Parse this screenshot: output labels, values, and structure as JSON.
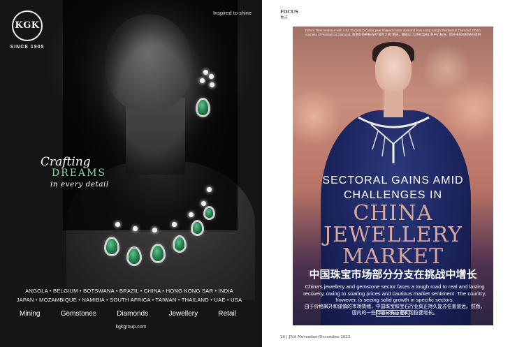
{
  "ad": {
    "logo_text": "KGK",
    "since": "SINCE 1905",
    "tagline": "Inspired to shine",
    "headline_script": "Crafting",
    "headline_main": "DREAMS",
    "headline_sub": "in every detail",
    "countries_line1": "ANGOLA • BELGIUM • BOTSWANA • BRAZIL • CHINA • HONG KONG SAR • INDIA",
    "countries_line2": "JAPAN • MOZAMBIQUE • NAMIBIA • SOUTH AFRICA • TAIWAN • THAILAND • UAE • USA",
    "divisions": [
      "Mining",
      "Gemstones",
      "Diamonds",
      "Jewellery",
      "Retail"
    ],
    "website": "kgkgroup.com",
    "colors": {
      "gem_green": "#1f7a4a",
      "accent_green": "#8fd3a8"
    }
  },
  "article": {
    "section": "FOCUS",
    "section_cn": "焦点",
    "photo_caption": "Before Time necklace with a 52.75 carat D-colour pear shaped centre diamond from Hong Kong's Pemberton Diamond. Photo courtesy of Pemberton Diamond. 香港彭伯顿钻石的\"彼时之眸\"项链，镶嵌52.75克拉梨形D色中心钻石。图片由彭伯顿钻石提供",
    "headline_line1": "SECTORAL GAINS AMID",
    "headline_line2": "CHALLENGES IN",
    "headline_big1": "CHINA",
    "headline_big2": "JEWELLERY",
    "headline_big3": "MARKET",
    "headline_cn": "中国珠宝市场部分分支在挑战中增长",
    "dek": "China's jewellery and gemstone sector faces a tough road to real and lasting recovery, owing to soaring prices and cautious market sentiment. The country, however, is seeing solid growth in specific sectors.",
    "dek_cn": "由于价格飙升和谨慎的市场情绪，中国珠宝和宝石行业真正持久复苏任重道远。然而，国内的一些特定分支正在实现稳健增长。",
    "byline": "Julius Zhang 郑峰",
    "folio": "26 | JNA  November/December 2023",
    "colors": {
      "headline_pink": "#d9a89d",
      "gown_blue": "#1d2660"
    }
  }
}
